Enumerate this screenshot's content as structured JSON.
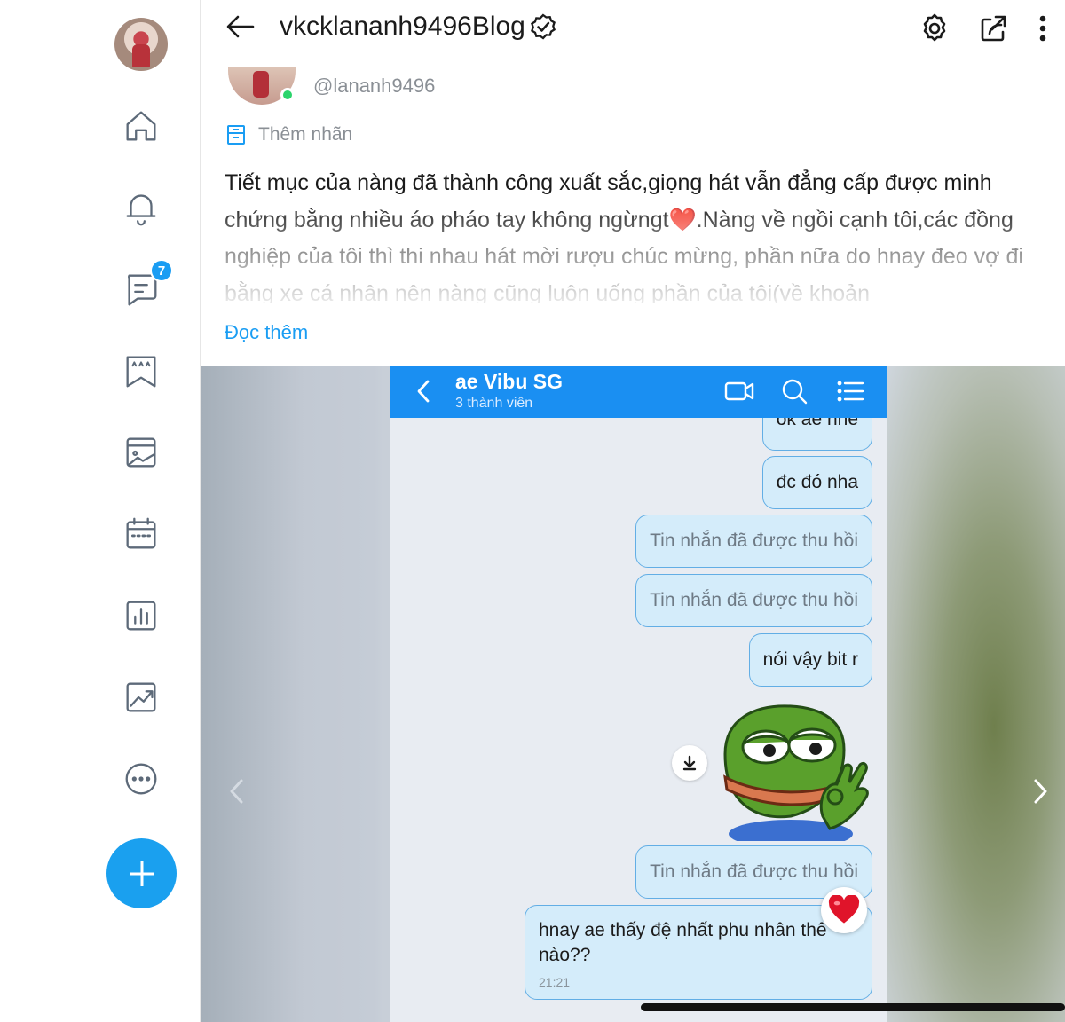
{
  "header": {
    "title": "vkcklananh9496Blog"
  },
  "sidebar": {
    "messages_badge": "7",
    "items": [
      "home-icon",
      "bell-icon",
      "chat-icon",
      "ratings-icon",
      "gallery-icon",
      "calendar-icon",
      "chart-icon",
      "trending-icon",
      "more-icon"
    ]
  },
  "post": {
    "handle": "@lananh9496",
    "tag_label": "Thêm nhãn",
    "text": "Tiết mục của nàng đã thành công xuất sắc,giọng hát vẫn đẳng cấp được minh chứng bằng nhiều áo pháo tay không ngừngt❤️.Nàng về ngồi cạnh tôi,các đồng nghiệp của tôi thì thi nhau hát mời rượu chúc mừng, phần nữa do hnay đeo vợ đi bằng xe cá nhân nên nàng cũng luôn uống phần của tôi(về khoản",
    "read_more": "Đọc thêm"
  },
  "chat": {
    "name": "ae Vibu SG",
    "members": "3 thành viên",
    "messages": [
      {
        "text": "ok ae nhe",
        "type": "text"
      },
      {
        "text": "đc đó nha",
        "type": "text"
      },
      {
        "text": "Tin nhắn đã được thu hồi",
        "type": "recalled"
      },
      {
        "text": "Tin nhắn đã được thu hồi",
        "type": "recalled"
      },
      {
        "text": "nói vậy bit r",
        "type": "text"
      },
      {
        "text": "Tin nhắn đã được thu hồi",
        "type": "recalled"
      },
      {
        "text": "hnay ae thấy đệ nhất phu nhân thế nào??",
        "type": "text",
        "time": "21:21"
      }
    ],
    "reaction": "heart"
  },
  "colors": {
    "accent": "#1a9df3",
    "chat_header": "#1a8ff2",
    "bubble_bg": "#d4ecfa",
    "bubble_border": "#62aee5",
    "online": "#2bd46b"
  }
}
